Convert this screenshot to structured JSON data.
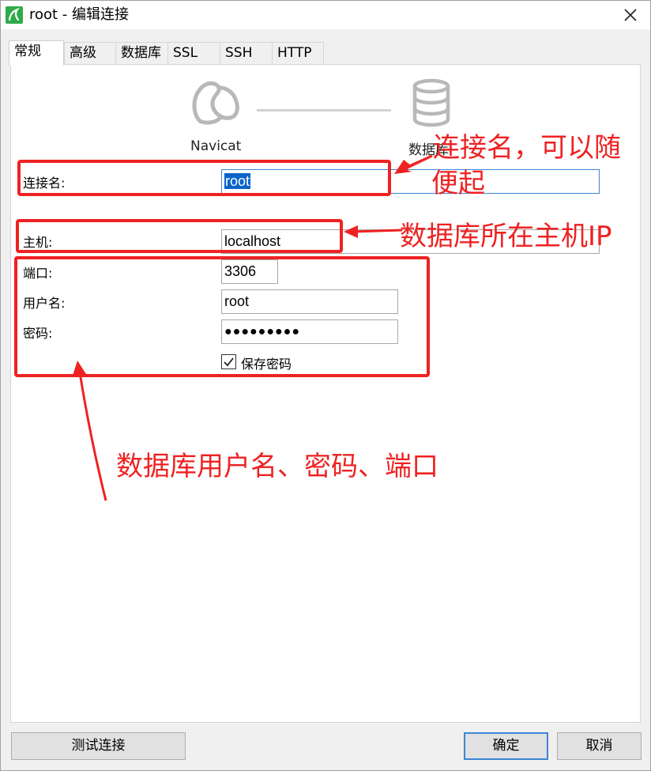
{
  "window": {
    "title": "root - 编辑连接"
  },
  "tabs": [
    "常规",
    "高级",
    "数据库",
    "SSL",
    "SSH",
    "HTTP"
  ],
  "diagram": {
    "client_label": "Navicat",
    "server_label": "数据库"
  },
  "form": {
    "connection_name_label": "连接名:",
    "connection_name_value": "root",
    "host_label": "主机:",
    "host_value": "localhost",
    "port_label": "端口:",
    "port_value": "3306",
    "username_label": "用户名:",
    "username_value": "root",
    "password_label": "密码:",
    "password_value": "●●●●●●●●●",
    "save_password_label": "保存密码",
    "save_password_checked": true
  },
  "annotations": {
    "connection_name_note_line1": "连接名，可以随",
    "connection_name_note_line2": "便起",
    "host_note": "数据库所在主机IP",
    "credentials_note": "数据库用户名、密码、端口",
    "color": "#ee2222"
  },
  "buttons": {
    "test": "测试连接",
    "ok": "确定",
    "cancel": "取消"
  },
  "colors": {
    "accent": "#3c86d6",
    "selection": "#0a64c8",
    "app_icon": "#2faa4a"
  }
}
